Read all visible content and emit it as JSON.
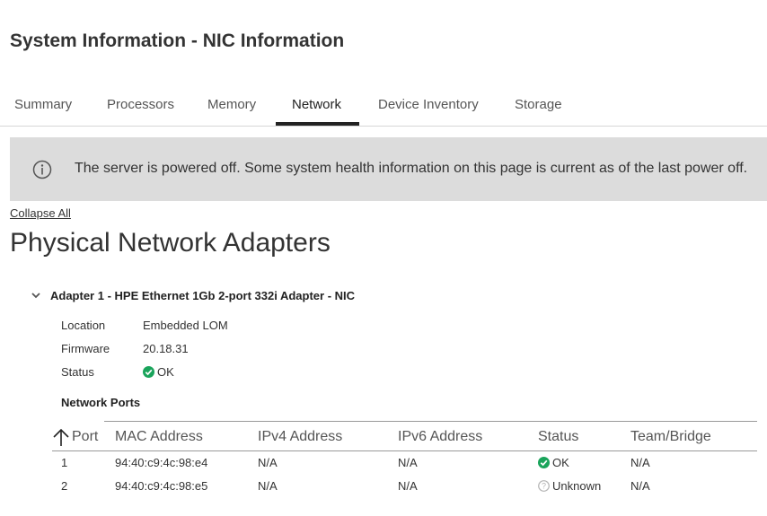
{
  "page": {
    "title": "System Information - NIC Information"
  },
  "tabs": [
    {
      "label": "Summary",
      "active": false
    },
    {
      "label": "Processors",
      "active": false
    },
    {
      "label": "Memory",
      "active": false
    },
    {
      "label": "Network",
      "active": true
    },
    {
      "label": "Device Inventory",
      "active": false
    },
    {
      "label": "Storage",
      "active": false
    }
  ],
  "banner": {
    "icon": "info-icon",
    "text": "The server is powered off. Some system health information on this page is current as of the last power off."
  },
  "collapse_all": "Collapse All",
  "section": {
    "heading": "Physical Network Adapters"
  },
  "adapter": {
    "title": "Adapter 1 - HPE Ethernet 1Gb 2-port 332i Adapter - NIC",
    "properties": [
      {
        "label": "Location",
        "value": "Embedded LOM"
      },
      {
        "label": "Firmware",
        "value": "20.18.31"
      },
      {
        "label": "Status",
        "value": "OK",
        "icon": "ok-icon"
      }
    ],
    "ports_title": "Network Ports",
    "columns": [
      "Port",
      "MAC Address",
      "IPv4 Address",
      "IPv6 Address",
      "Status",
      "Team/Bridge"
    ],
    "rows": [
      {
        "port": "1",
        "mac": "94:40:c9:4c:98:e4",
        "ipv4": "N/A",
        "ipv6": "N/A",
        "status": "OK",
        "status_icon": "ok-icon",
        "team": "N/A"
      },
      {
        "port": "2",
        "mac": "94:40:c9:4c:98:e5",
        "ipv4": "N/A",
        "ipv6": "N/A",
        "status": "Unknown",
        "status_icon": "unknown-icon",
        "team": "N/A"
      }
    ]
  },
  "colors": {
    "ok": "#1aa45b",
    "unknown": "#b5b5b5",
    "banner_bg": "#dcdcdc",
    "tab_active": "#222222"
  }
}
